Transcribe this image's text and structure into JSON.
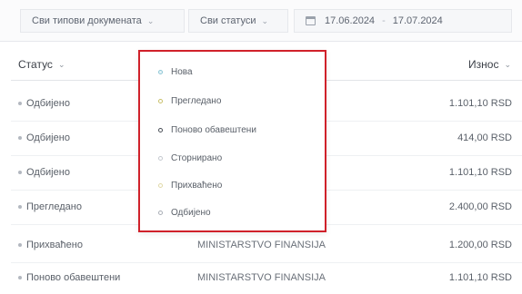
{
  "filters": {
    "doc_types": "Сви типови докумената",
    "statuses": "Сви статуси",
    "date_from": "17.06.2024",
    "date_sep": "-",
    "date_to": "17.07.2024"
  },
  "table": {
    "col_status": "Статус",
    "col_amount": "Износ",
    "rows": [
      {
        "status": "Одбијено",
        "issuer": "",
        "amount": "1.101,10 RSD"
      },
      {
        "status": "Одбијено",
        "issuer": "",
        "amount": "414,00 RSD"
      },
      {
        "status": "Одбијено",
        "issuer": "",
        "amount": "1.101,10 RSD"
      },
      {
        "status": "Прегледано",
        "issuer": "",
        "amount": "2.400,00 RSD"
      },
      {
        "status": "Прихваћено",
        "issuer": "MINISTARSTVO FINANSIJA",
        "amount": "1.200,00 RSD"
      },
      {
        "status": "Поново обавештени",
        "issuer": "MINISTARSTVO FINANSIJA",
        "amount": "1.101,10 RSD"
      }
    ]
  },
  "status_dropdown": {
    "options": [
      "Нова",
      "Прегледано",
      "Поново обавештени",
      "Сторнирано",
      "Прихваћено",
      "Одбијено"
    ]
  },
  "chevron": "⌄",
  "colors": {
    "highlight_border": "#d0212a"
  }
}
